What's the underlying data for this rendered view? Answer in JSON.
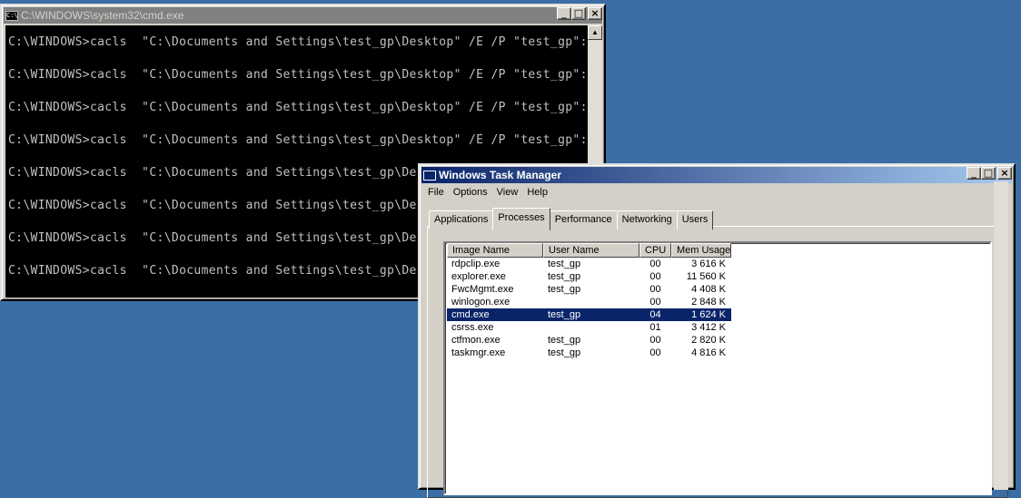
{
  "cmd": {
    "title": "C:\\WINDOWS\\system32\\cmd.exe",
    "icon_text": "C:\\",
    "lines": [
      "C:\\WINDOWS>cacls  \"C:\\Documents and Settings\\test_gp\\Desktop\" /E /P \"test_gp\":R",
      "C:\\WINDOWS>cacls  \"C:\\Documents and Settings\\test_gp\\Desktop\" /E /P \"test_gp\":R",
      "C:\\WINDOWS>cacls  \"C:\\Documents and Settings\\test_gp\\Desktop\" /E /P \"test_gp\":R",
      "C:\\WINDOWS>cacls  \"C:\\Documents and Settings\\test_gp\\Desktop\" /E /P \"test_gp\":R",
      "C:\\WINDOWS>cacls  \"C:\\Documents and Settings\\test_gp\\Desk",
      "C:\\WINDOWS>cacls  \"C:\\Documents and Settings\\test_gp\\Desk",
      "C:\\WINDOWS>cacls  \"C:\\Documents and Settings\\test_gp\\Desk",
      "C:\\WINDOWS>cacls  \"C:\\Documents and Settings\\test_gp\\Desk"
    ]
  },
  "taskmgr": {
    "title": "Windows Task Manager",
    "menu": [
      "File",
      "Options",
      "View",
      "Help"
    ],
    "tabs": [
      "Applications",
      "Processes",
      "Performance",
      "Networking",
      "Users"
    ],
    "active_tab": "Processes",
    "columns": [
      "Image Name",
      "User Name",
      "CPU",
      "Mem Usage"
    ],
    "processes": [
      {
        "image": "rdpclip.exe",
        "user": "test_gp",
        "cpu": "00",
        "mem": "3 616 K"
      },
      {
        "image": "explorer.exe",
        "user": "test_gp",
        "cpu": "00",
        "mem": "11 560 K"
      },
      {
        "image": "FwcMgmt.exe",
        "user": "test_gp",
        "cpu": "00",
        "mem": "4 408 K"
      },
      {
        "image": "winlogon.exe",
        "user": "",
        "cpu": "00",
        "mem": "2 848 K"
      },
      {
        "image": "cmd.exe",
        "user": "test_gp",
        "cpu": "04",
        "mem": "1 624 K"
      },
      {
        "image": "csrss.exe",
        "user": "",
        "cpu": "01",
        "mem": "3 412 K"
      },
      {
        "image": "ctfmon.exe",
        "user": "test_gp",
        "cpu": "00",
        "mem": "2 820 K"
      },
      {
        "image": "taskmgr.exe",
        "user": "test_gp",
        "cpu": "00",
        "mem": "4 816 K"
      }
    ],
    "selected_row": 4
  },
  "window_buttons": {
    "minimize": "_",
    "maximize": "□",
    "close": "×"
  },
  "colors": {
    "desktop": "#3a6ea5",
    "selection": "#0a246a",
    "console_text": "#c0c0c0"
  }
}
